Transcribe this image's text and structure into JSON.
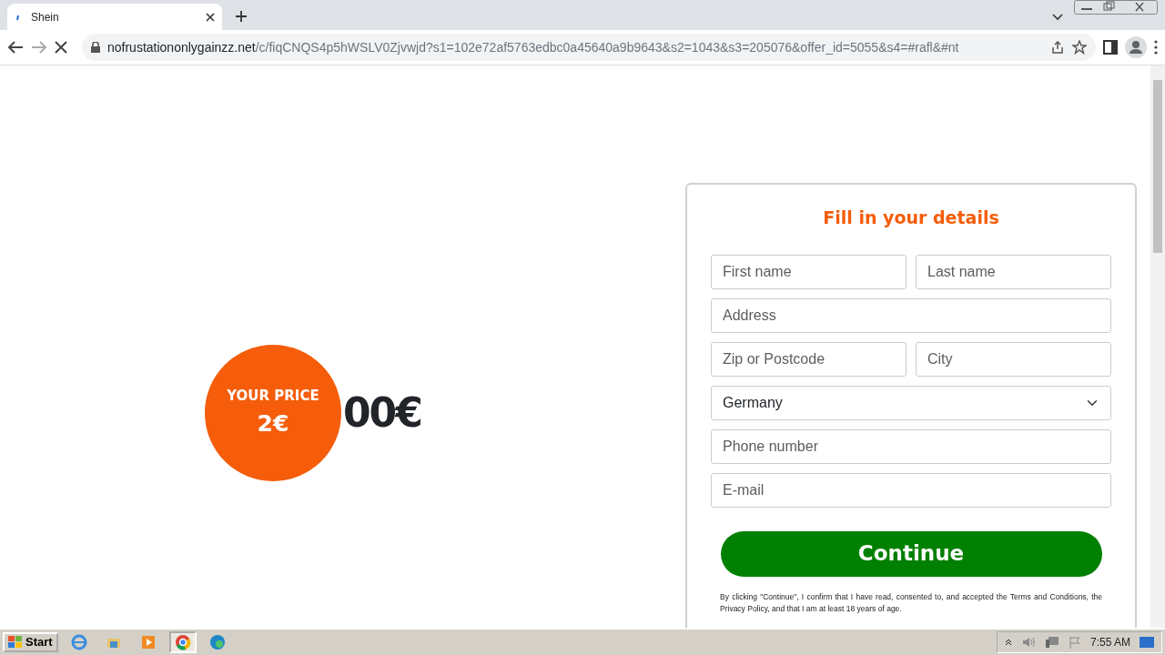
{
  "browser": {
    "tabs": [
      {
        "title": "Shein",
        "selected": true
      }
    ],
    "url_host": "nofrustationonlygainzz.net",
    "url_path": "/c/fiqCNQS4p5hWSLV0Zjvwjd?s1=102e72af5763edbc0a45640a9b9643&s2=1043&s3=205076&offer_id=5055&s4=#rafl&#nt",
    "loading": true
  },
  "offer": {
    "badge_label": "YOUR PRICE",
    "badge_price": "2€",
    "old_price": "00€"
  },
  "form": {
    "title": "Fill in your details",
    "rows": [
      [
        {
          "kind": "input",
          "placeholder": "First name"
        },
        {
          "kind": "input",
          "placeholder": "Last name"
        }
      ],
      [
        {
          "kind": "input",
          "placeholder": "Address"
        }
      ],
      [
        {
          "kind": "input",
          "placeholder": "Zip or Postcode"
        },
        {
          "kind": "input",
          "placeholder": "City"
        }
      ],
      [
        {
          "kind": "select",
          "value": "Germany"
        }
      ],
      [
        {
          "kind": "input",
          "placeholder": "Phone number"
        }
      ],
      [
        {
          "kind": "input",
          "placeholder": "E-mail"
        }
      ]
    ],
    "button": "Continue",
    "disclaimer": "By clicking \"Continue\", I confirm that I have read, consented to, and accepted the Terms and Conditions, the Privacy Policy, and that I am at least 18 years of age."
  },
  "taskbar": {
    "start": "Start",
    "apps": [
      {
        "kind": "ie",
        "active": false
      },
      {
        "kind": "folder",
        "active": false
      },
      {
        "kind": "media",
        "active": false
      },
      {
        "kind": "chrome",
        "active": true
      },
      {
        "kind": "edge",
        "active": false
      }
    ],
    "clock": "7:55 AM"
  }
}
